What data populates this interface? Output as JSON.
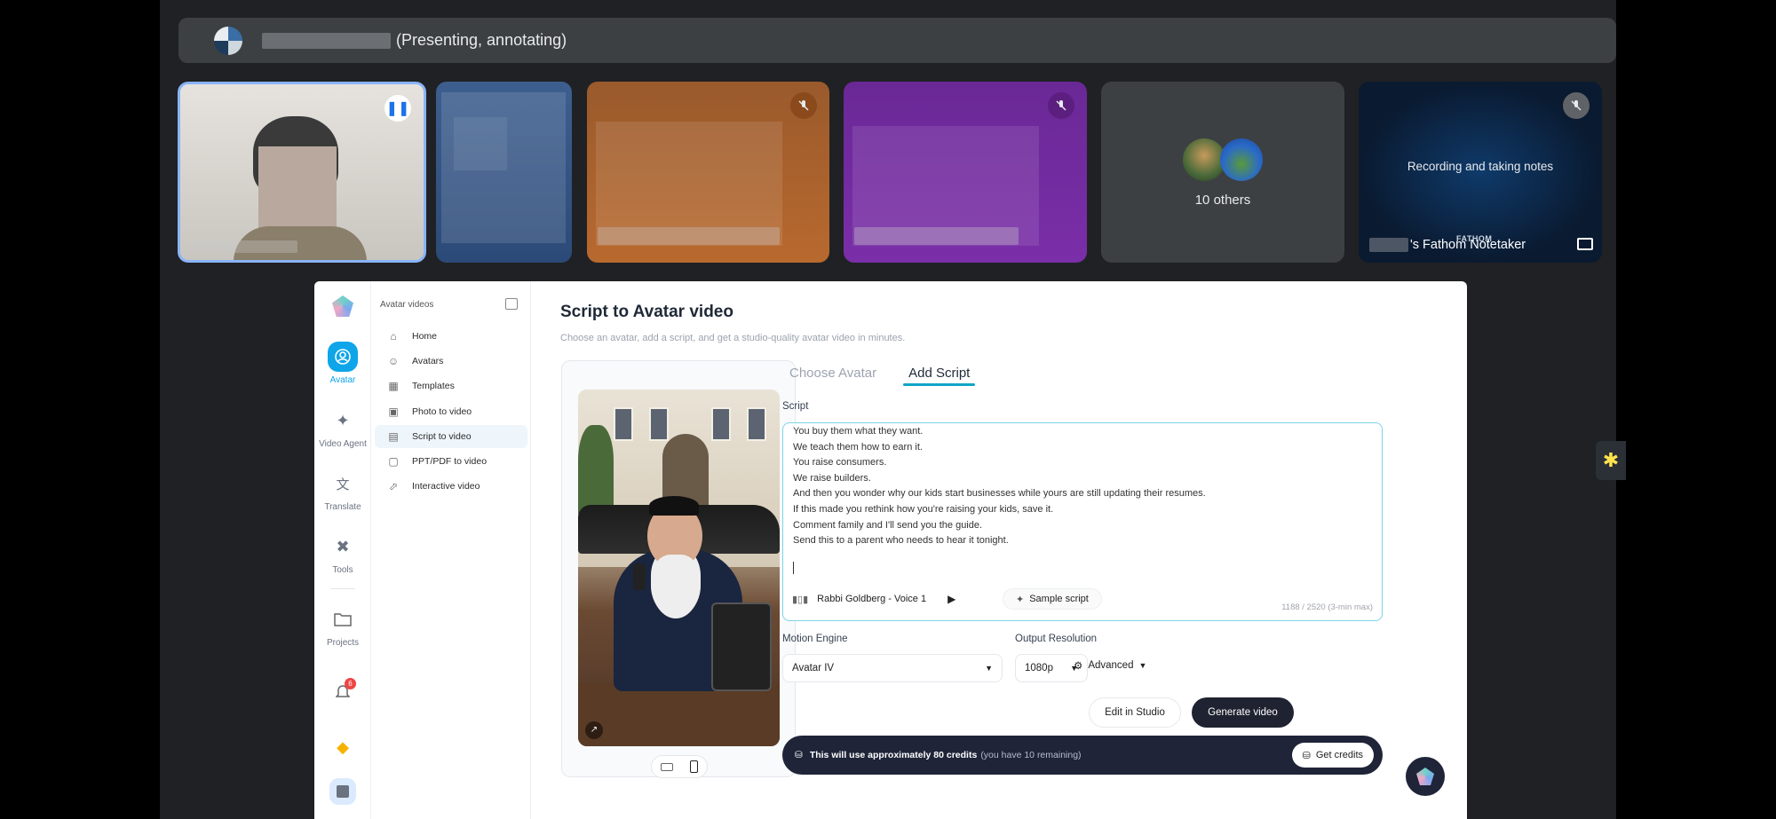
{
  "meeting": {
    "presenter_status": "(Presenting, annotating)",
    "others_label": "10 others",
    "notetaker_message": "Recording and taking notes",
    "notetaker_brand": "FATHOM",
    "notetaker_name": "'s Fathom Notetaker"
  },
  "app": {
    "rail": [
      {
        "label": "Avatar",
        "icon": "avatar-icon",
        "active": true
      },
      {
        "label": "Video Agent",
        "icon": "wand-icon"
      },
      {
        "label": "Translate",
        "icon": "translate-icon"
      },
      {
        "label": "Tools",
        "icon": "tools-icon"
      },
      {
        "label": "Projects",
        "icon": "folder-icon"
      }
    ],
    "notification_count": "6",
    "sidebar": {
      "title": "Avatar videos",
      "items": [
        {
          "label": "Home",
          "icon": "home-icon"
        },
        {
          "label": "Avatars",
          "icon": "avatar-icon"
        },
        {
          "label": "Templates",
          "icon": "template-icon"
        },
        {
          "label": "Photo to video",
          "icon": "photo-icon"
        },
        {
          "label": "Script to video",
          "icon": "script-icon",
          "active": true
        },
        {
          "label": "PPT/PDF to video",
          "icon": "document-icon"
        },
        {
          "label": "Interactive video",
          "icon": "pointer-icon"
        }
      ]
    },
    "page": {
      "title": "Script to Avatar video",
      "subtitle": "Choose an avatar, add a script, and get a studio-quality avatar video in minutes."
    },
    "tabs": [
      {
        "label": "Choose Avatar"
      },
      {
        "label": "Add Script",
        "active": true
      }
    ],
    "script": {
      "label": "Script",
      "text": "You buy them what they want.\nWe teach them how to earn it.\nYou raise consumers.\nWe raise builders.\nAnd then you wonder why our kids start businesses while yours are still updating their resumes.\nIf this made you rethink how you're raising your kids, save it.\nComment family and I'll send you the guide.\nSend this to a parent who needs to hear it tonight.",
      "voice": "Rabbi Goldberg - Voice 1",
      "sample_label": "Sample script",
      "count": "1188 / 2520 (3-min max)"
    },
    "motion_engine": {
      "label": "Motion Engine",
      "value": "Avatar IV"
    },
    "output_resolution": {
      "label": "Output Resolution",
      "value": "1080p"
    },
    "advanced_label": "Advanced",
    "edit_label": "Edit in Studio",
    "generate_label": "Generate video",
    "credits": {
      "main": "This will use approximately 80 credits",
      "remaining": "(you have 10 remaining)",
      "button": "Get credits"
    }
  },
  "colors": {
    "accent": "#0ea5c6",
    "dark": "#1f2438",
    "meet_bg": "#202124"
  }
}
